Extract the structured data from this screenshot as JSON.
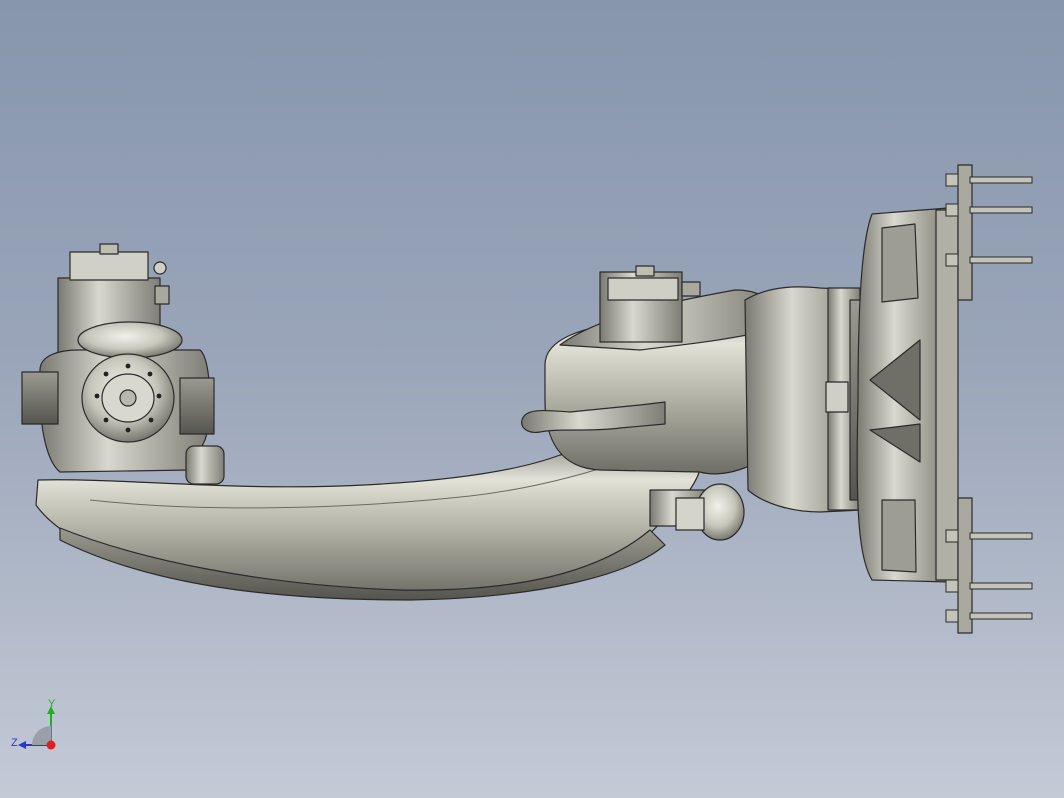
{
  "view": {
    "background_top": "#8796ad",
    "background_bottom": "#c4cad6",
    "model_color": "#b9b9ad",
    "model_edge": "#2a2a2a"
  },
  "triad": {
    "y_label": "Y",
    "z_label": "Z",
    "y_color": "#18b418",
    "z_color": "#2a35d8",
    "x_color": "#e02020"
  }
}
